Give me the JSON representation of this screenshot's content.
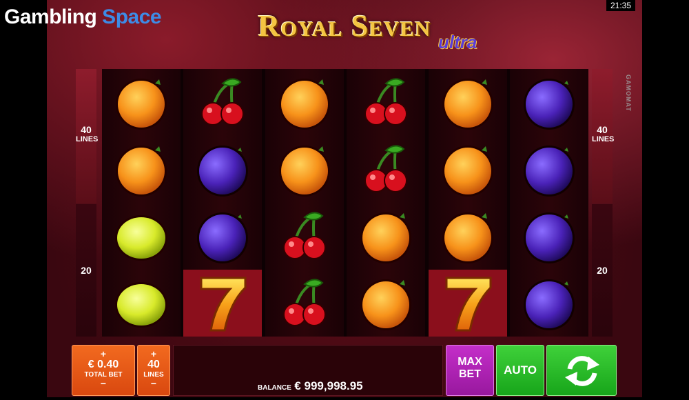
{
  "watermark": {
    "part1": "Gambling",
    "part2": " Space"
  },
  "clock": "21:35",
  "game": {
    "title": "Royal Seven",
    "subtitle": "ultra"
  },
  "provider": "GAMOMAT",
  "sides": {
    "left_top_lines": "40",
    "left_top_label": "LINES",
    "left_bottom": "20",
    "right_top_lines": "40",
    "right_top_label": "LINES",
    "right_bottom": "20"
  },
  "reels": [
    [
      "orange",
      "orange",
      "lemon",
      "lemon"
    ],
    [
      "cherry",
      "plum",
      "plum",
      "seven"
    ],
    [
      "orange",
      "orange",
      "cherry",
      "cherry"
    ],
    [
      "cherry",
      "cherry",
      "orange",
      "orange"
    ],
    [
      "orange",
      "orange",
      "orange",
      "seven"
    ],
    [
      "plum",
      "plum",
      "plum",
      "plum"
    ]
  ],
  "controls": {
    "bet_plus": "+",
    "bet_value": "€ 0.40",
    "bet_label": "TOTAL BET",
    "bet_minus": "−",
    "lines_plus": "+",
    "lines_value": "40",
    "lines_label": "LINES",
    "lines_minus": "−",
    "max_bet_line1": "MAX",
    "max_bet_line2": "BET",
    "auto": "AUTO",
    "balance_label": "BALANCE",
    "balance_value": "€ 999,998.95"
  },
  "colors": {
    "orange_button": "#e5561a",
    "purple_button": "#b022b6",
    "green_button": "#2bbd2a",
    "reel_bg": "#2b0409"
  }
}
